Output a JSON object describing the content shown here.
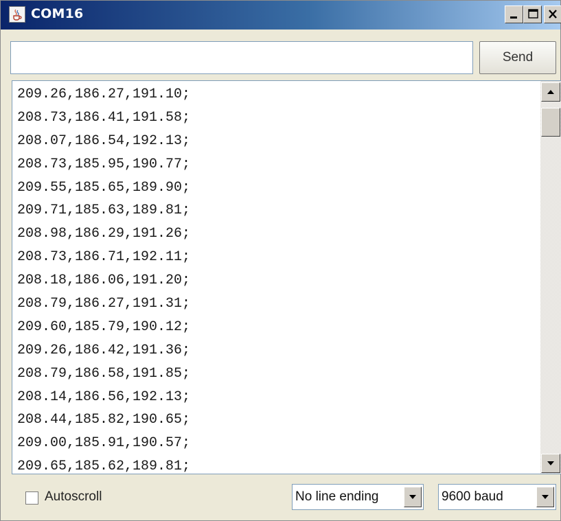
{
  "window": {
    "title": "COM16",
    "app_icon": "java-cup-icon",
    "controls": [
      "minimize-icon",
      "maximize-icon",
      "close-icon"
    ]
  },
  "send_bar": {
    "input_value": "",
    "input_placeholder": "",
    "send_label": "Send"
  },
  "output": {
    "lines": [
      "209.26,186.27,191.10;",
      "208.73,186.41,191.58;",
      "208.07,186.54,192.13;",
      "208.73,185.95,190.77;",
      "209.55,185.65,189.90;",
      "209.71,185.63,189.81;",
      "208.98,186.29,191.26;",
      "208.73,186.71,192.11;",
      "208.18,186.06,191.20;",
      "208.79,186.27,191.31;",
      "209.60,185.79,190.12;",
      "209.26,186.42,191.36;",
      "208.79,186.58,191.85;",
      "208.14,186.56,192.13;",
      "208.44,185.82,190.65;",
      "209.00,185.91,190.57;",
      "209.65,185.62,189.81;"
    ]
  },
  "footer": {
    "autoscroll_label": "Autoscroll",
    "autoscroll_checked": false,
    "line_ending_selected": "No line ending",
    "baud_selected": "9600 baud"
  },
  "colors": {
    "titlebar_start": "#0a246a",
    "titlebar_end": "#a6caf0",
    "window_bg": "#ece9d8",
    "field_border": "#7f9db9"
  }
}
